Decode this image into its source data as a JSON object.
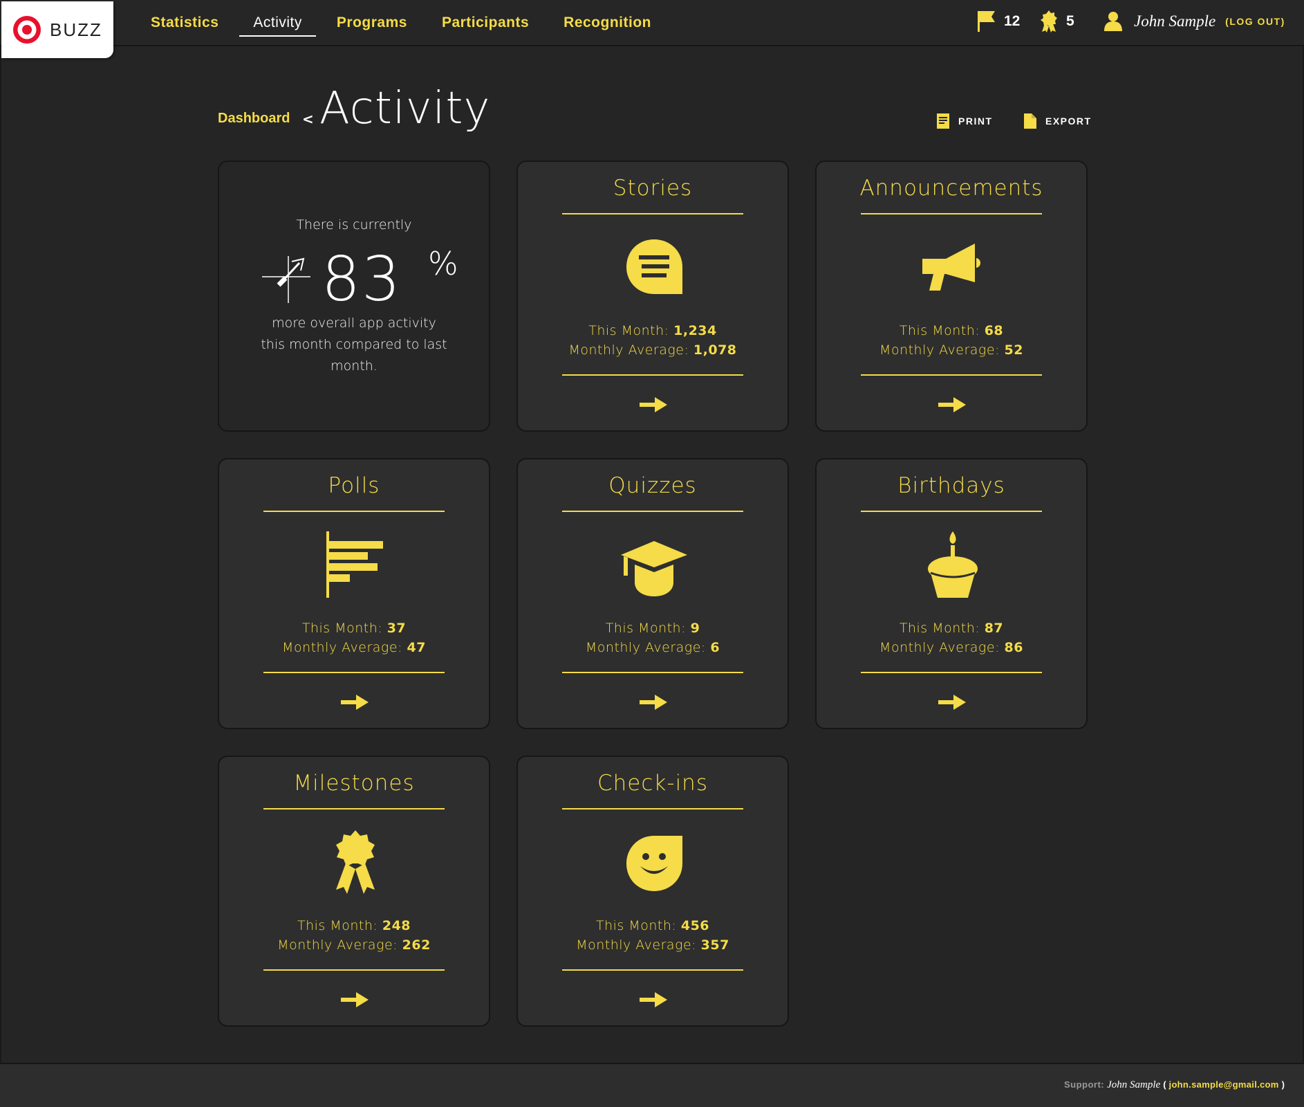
{
  "brand": {
    "name": "BUZZ",
    "accent": "#f5dc48",
    "logo_red": "#e8112d"
  },
  "nav": [
    {
      "label": "Statistics"
    },
    {
      "label": "Activity"
    },
    {
      "label": "Programs"
    },
    {
      "label": "Participants"
    },
    {
      "label": "Recognition"
    }
  ],
  "header": {
    "flags": {
      "icon": "flag-icon",
      "count": "12"
    },
    "awards": {
      "icon": "award-icon",
      "count": "5"
    },
    "user": {
      "icon": "user-icon",
      "name": "John Sample",
      "logout": "(LOG OUT)"
    }
  },
  "page": {
    "breadcrumb": "Dashboard",
    "separator": "<",
    "title": "Activity",
    "print_label": "PRINT",
    "export_label": "EXPORT"
  },
  "hero": {
    "pre": "There is currently",
    "value": "83",
    "unit": "%",
    "description": "more overall app activity this month compared to last month."
  },
  "cards": [
    {
      "title": "Stories",
      "icon": "speech-bubble-icon",
      "month_label": "This Month:",
      "month": "1,234",
      "avg_label": "Monthly Average:",
      "avg": "1,078"
    },
    {
      "title": "Announcements",
      "icon": "megaphone-icon",
      "month_label": "This Month:",
      "month": "68",
      "avg_label": "Monthly Average:",
      "avg": "52"
    },
    {
      "title": "Polls",
      "icon": "bar-chart-icon",
      "month_label": "This Month:",
      "month": "37",
      "avg_label": "Monthly Average:",
      "avg": "47"
    },
    {
      "title": "Quizzes",
      "icon": "graduation-cap-icon",
      "month_label": "This Month:",
      "month": "9",
      "avg_label": "Monthly Average:",
      "avg": "6"
    },
    {
      "title": "Birthdays",
      "icon": "cupcake-icon",
      "month_label": "This Month:",
      "month": "87",
      "avg_label": "Monthly Average:",
      "avg": "86"
    },
    {
      "title": "Milestones",
      "icon": "ribbon-award-icon",
      "month_label": "This Month:",
      "month": "248",
      "avg_label": "Monthly Average:",
      "avg": "262"
    },
    {
      "title": "Check-ins",
      "icon": "smiley-icon",
      "month_label": "This Month:",
      "month": "456",
      "avg_label": "Monthly Average:",
      "avg": "357"
    }
  ],
  "footer": {
    "label": "Support:",
    "name": "John Sample",
    "email": "john.sample@gmail.com"
  }
}
